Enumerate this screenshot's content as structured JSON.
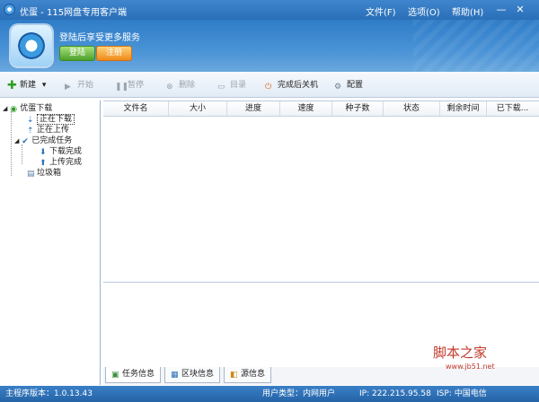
{
  "titlebar": {
    "title": "优蛋 - 115网盘专用客户端",
    "menu": [
      "文件(F)",
      "选项(O)",
      "帮助(H)"
    ],
    "controls": [
      "—",
      "✕"
    ]
  },
  "banner": {
    "promo": "登陆后享受更多服务",
    "login_label": "登陆",
    "register_label": "注册"
  },
  "toolbar": {
    "new_label": "新建",
    "start_label": "开始",
    "pause_label": "暂停",
    "delete_label": "删除",
    "folder_label": "目录",
    "shutdown_label": "完成后关机",
    "config_label": "配置"
  },
  "sidebar": {
    "root": "优蛋下载",
    "downloading": "正在下载",
    "uploading": "正在上传",
    "completed": "已完成任务",
    "download_done": "下载完成",
    "upload_done": "上传完成",
    "trash": "垃圾箱"
  },
  "table": {
    "columns": [
      "文件名",
      "大小",
      "进度",
      "速度",
      "种子数",
      "状态",
      "剩余时间",
      "已下载..."
    ]
  },
  "tabs": {
    "task_info": "任务信息",
    "block_info": "区块信息",
    "source_info": "源信息"
  },
  "statusbar": {
    "version": "主程序版本：1.0.13.43",
    "user_type": "用户类型：内网用户",
    "ip": "IP: 222.215.95.58",
    "isp": "ISP: 中国电信"
  },
  "watermark": {
    "text": "脚本之家",
    "url": "www.jb51.net"
  },
  "colors": {
    "titlebar": "#2a6fb7",
    "statusbar": "#2463a6",
    "login_green": "#4ea02c",
    "register_orange": "#f08a18"
  }
}
